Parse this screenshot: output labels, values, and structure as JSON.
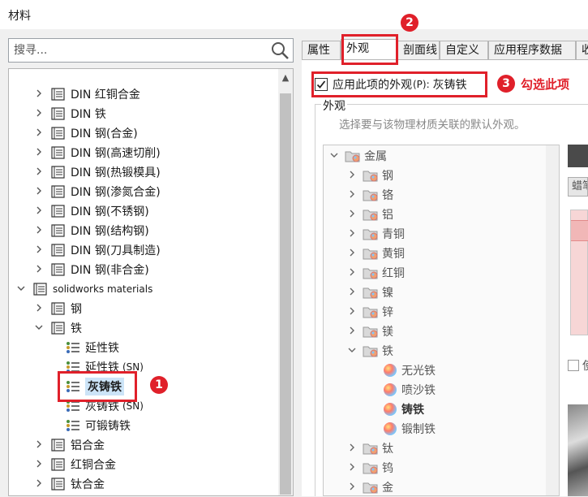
{
  "window": {
    "title": "材料"
  },
  "search": {
    "placeholder": "搜寻..."
  },
  "tree": [
    {
      "label": "DIN 红铜合金",
      "indent": 1,
      "kind": "library",
      "expander": ">"
    },
    {
      "label": "DIN 铁",
      "indent": 1,
      "kind": "library",
      "expander": ">"
    },
    {
      "label": "DIN 钢(合金)",
      "indent": 1,
      "kind": "library",
      "expander": ">"
    },
    {
      "label": "DIN 钢(高速切削)",
      "indent": 1,
      "kind": "library",
      "expander": ">"
    },
    {
      "label": "DIN 钢(热锻模具)",
      "indent": 1,
      "kind": "library",
      "expander": ">"
    },
    {
      "label": "DIN 钢(渗氮合金)",
      "indent": 1,
      "kind": "library",
      "expander": ">"
    },
    {
      "label": "DIN 钢(不锈钢)",
      "indent": 1,
      "kind": "library",
      "expander": ">"
    },
    {
      "label": "DIN 钢(结构钢)",
      "indent": 1,
      "kind": "library",
      "expander": ">"
    },
    {
      "label": "DIN 钢(刀具制造)",
      "indent": 1,
      "kind": "library",
      "expander": ">"
    },
    {
      "label": "DIN 钢(非合金)",
      "indent": 1,
      "kind": "library",
      "expander": ">"
    },
    {
      "label": "solidworks materials",
      "indent": 0,
      "kind": "library",
      "expander": "v",
      "small": true
    },
    {
      "label": "钢",
      "indent": 1,
      "kind": "library",
      "expander": ">"
    },
    {
      "label": "铁",
      "indent": 1,
      "kind": "library",
      "expander": "v"
    },
    {
      "label": "延性铁",
      "indent": 2,
      "kind": "material"
    },
    {
      "label": "延性铁",
      "suffix": "(SN)",
      "indent": 2,
      "kind": "material"
    },
    {
      "label": "灰铸铁",
      "indent": 2,
      "kind": "material",
      "selected": true
    },
    {
      "label": "灰铸铁",
      "suffix": "(SN)",
      "indent": 2,
      "kind": "material"
    },
    {
      "label": "可锻铸铁",
      "indent": 2,
      "kind": "material"
    },
    {
      "label": "铝合金",
      "indent": 1,
      "kind": "library",
      "expander": ">"
    },
    {
      "label": "红铜合金",
      "indent": 1,
      "kind": "library",
      "expander": ">"
    },
    {
      "label": "钛合金",
      "indent": 1,
      "kind": "library",
      "expander": ">"
    }
  ],
  "tabs": [
    {
      "label": "属性",
      "active": false
    },
    {
      "label": "外观",
      "active": true
    },
    {
      "label": "剖面线",
      "active": false
    },
    {
      "label": "自定义",
      "active": false
    },
    {
      "label": "应用程序数据",
      "active": false
    },
    {
      "label": "收",
      "active": false
    }
  ],
  "apply_checkbox": {
    "label": "应用此项的外观",
    "accel": "(P):",
    "value": "灰铸铁",
    "checked": true
  },
  "appearance_group": {
    "legend": "外观",
    "description": "选择要与该物理材质关联的默认外观。",
    "tree": [
      {
        "label": "金属",
        "indent": 0,
        "kind": "folder",
        "expander": "v"
      },
      {
        "label": "钢",
        "indent": 1,
        "kind": "folder",
        "expander": ">"
      },
      {
        "label": "铬",
        "indent": 1,
        "kind": "folder",
        "expander": ">"
      },
      {
        "label": "铝",
        "indent": 1,
        "kind": "folder",
        "expander": ">"
      },
      {
        "label": "青铜",
        "indent": 1,
        "kind": "folder",
        "expander": ">"
      },
      {
        "label": "黄铜",
        "indent": 1,
        "kind": "folder",
        "expander": ">"
      },
      {
        "label": "红铜",
        "indent": 1,
        "kind": "folder",
        "expander": ">"
      },
      {
        "label": "镍",
        "indent": 1,
        "kind": "folder",
        "expander": ">"
      },
      {
        "label": "锌",
        "indent": 1,
        "kind": "folder",
        "expander": ">"
      },
      {
        "label": "镁",
        "indent": 1,
        "kind": "folder",
        "expander": ">"
      },
      {
        "label": "铁",
        "indent": 1,
        "kind": "folder",
        "expander": "v"
      },
      {
        "label": "无光铁",
        "indent": 2,
        "kind": "appearance"
      },
      {
        "label": "喷沙铁",
        "indent": 2,
        "kind": "appearance"
      },
      {
        "label": "铸铁",
        "indent": 2,
        "kind": "appearance",
        "bold": true
      },
      {
        "label": "锻制铁",
        "indent": 2,
        "kind": "appearance"
      },
      {
        "label": "钛",
        "indent": 1,
        "kind": "folder",
        "expander": ">"
      },
      {
        "label": "钨",
        "indent": 1,
        "kind": "folder",
        "expander": ">"
      },
      {
        "label": "金",
        "indent": 1,
        "kind": "folder",
        "expander": ">"
      }
    ]
  },
  "partial": {
    "button_label": "蜡笔",
    "checkbox_label": "使"
  },
  "annotations": {
    "step1": "1",
    "step2": "2",
    "step3": "3",
    "step3_text": "勾选此项",
    "color": "#e0202a"
  }
}
